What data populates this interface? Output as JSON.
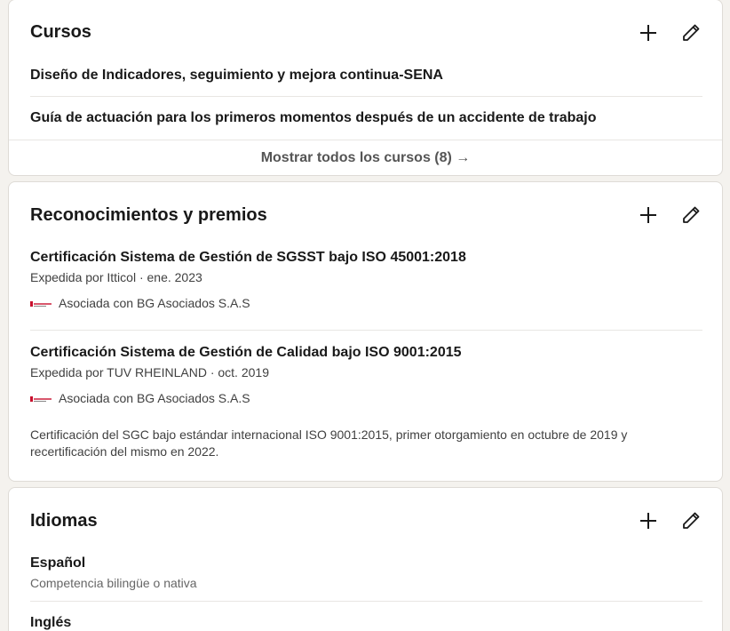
{
  "courses": {
    "title": "Cursos",
    "items": [
      {
        "name": "Diseño de Indicadores, seguimiento y mejora continua-SENA"
      },
      {
        "name": "Guía de actuación para los primeros momentos después de un accidente de trabajo"
      }
    ],
    "show_all_label": "Mostrar todos los cursos (8) →"
  },
  "awards": {
    "title": "Reconocimientos y premios",
    "items": [
      {
        "name": "Certificación Sistema de Gestión de SGSST bajo ISO 45001:2018",
        "issuer": "Expedida por Itticol · ene. 2023",
        "association": "Asociada con BG Asociados S.A.S"
      },
      {
        "name": "Certificación Sistema de Gestión de Calidad bajo ISO 9001:2015",
        "issuer": "Expedida por TUV RHEINLAND · oct. 2019",
        "association": "Asociada con BG Asociados S.A.S",
        "description": "Certificación del SGC bajo estándar internacional ISO 9001:2015, primer otorgamiento en octubre de 2019 y recertificación del mismo en 2022."
      }
    ]
  },
  "languages": {
    "title": "Idiomas",
    "items": [
      {
        "name": "Español",
        "level": "Competencia bilingüe o nativa"
      },
      {
        "name": "Inglés"
      }
    ]
  },
  "icons": {
    "add": "plus-icon",
    "edit": "pencil-icon"
  },
  "colors": {
    "background": "#f4f2ee",
    "card": "#ffffff",
    "text": "#191919",
    "muted": "#666666"
  }
}
